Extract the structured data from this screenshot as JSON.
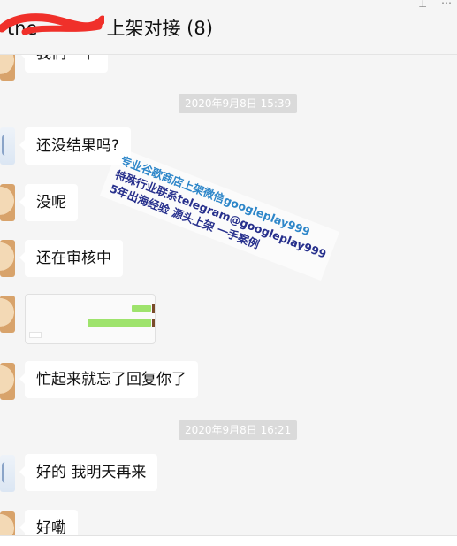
{
  "header": {
    "title_visible": "the",
    "title_suffix": "上架对接 (8)",
    "redaction_color": "#f0302a"
  },
  "messages": [
    {
      "type": "text",
      "text": "我们一下"
    },
    {
      "type": "timestamp",
      "text": "2020年9月8日 15:39"
    },
    {
      "type": "text",
      "text": "还没结果吗?"
    },
    {
      "type": "text",
      "text": "没呢"
    },
    {
      "type": "text",
      "text": "还在审核中"
    },
    {
      "type": "image"
    },
    {
      "type": "text",
      "text": "忙起来就忘了回复你了"
    },
    {
      "type": "timestamp",
      "text": "2020年9月8日 16:21"
    },
    {
      "type": "text",
      "text": "好的  我明天再来"
    },
    {
      "type": "text",
      "text": "好嘞"
    }
  ],
  "watermark": {
    "line1": "专业谷歌商店上架微信googleplay999",
    "line2": "特殊行业联系telegram@googleplay999",
    "line3": "5年出海经验   源头上架   一手案例"
  },
  "icons": [
    "pin-icon",
    "more-icon"
  ]
}
